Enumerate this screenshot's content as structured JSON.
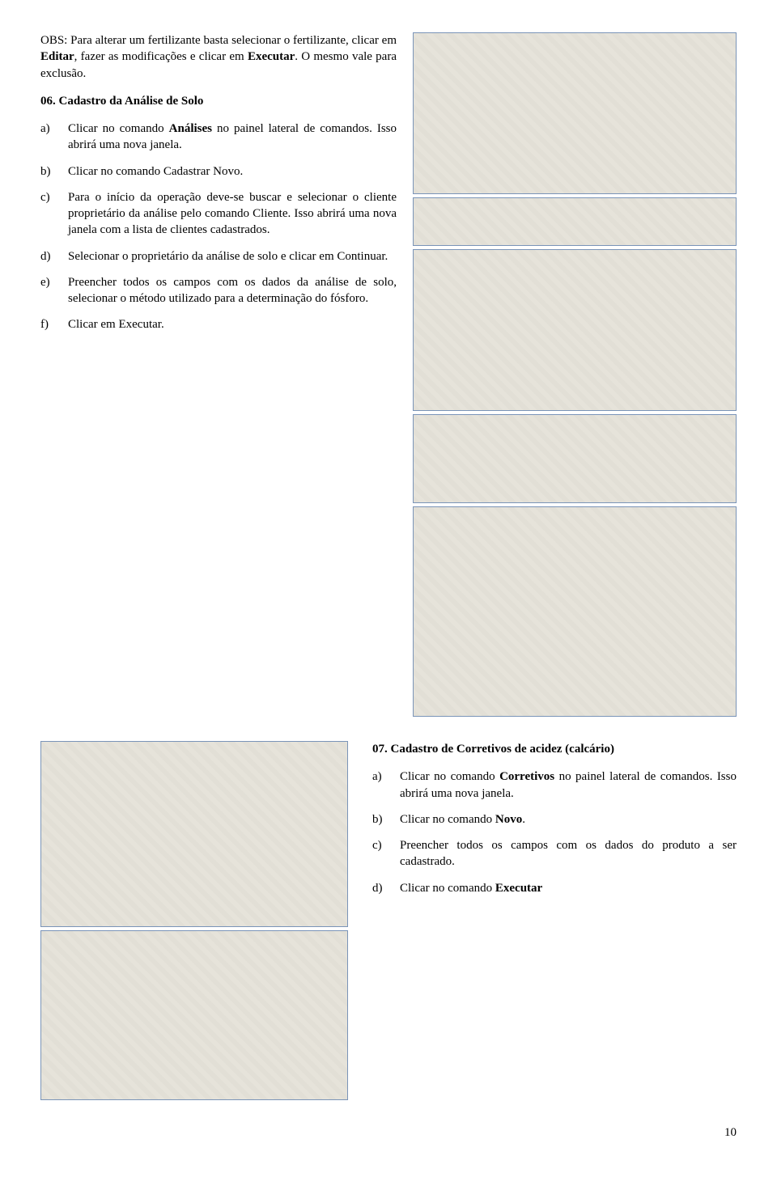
{
  "sec06": {
    "obs": "OBS: Para alterar um fertilizante basta selecionar o fertilizante, clicar em ",
    "obs_b1": "Editar",
    "obs_mid": ", fazer as modificações e clicar em ",
    "obs_b2": "Executar",
    "obs_end": ". O mesmo vale para exclusão.",
    "title": "06. Cadastro da Análise de Solo",
    "a_lbl": "a)",
    "a_pre": "Clicar no comando ",
    "a_b": "Análises",
    "a_post": " no painel lateral de comandos. Isso abrirá uma nova janela.",
    "b_lbl": "b)",
    "b_txt": "Clicar no comando Cadastrar Novo.",
    "c_lbl": "c)",
    "c_txt": "Para o início da operação deve-se buscar e selecionar o cliente proprietário da análise pelo comando Cliente. Isso abrirá uma nova janela com a lista de clientes cadastrados.",
    "d_lbl": "d)",
    "d_txt": "Selecionar o proprietário da análise de solo e clicar em Continuar.",
    "e_lbl": "e)",
    "e_txt": "Preencher todos os campos com os dados da análise de solo, selecionar o método utilizado para a determinação do fósforo.",
    "f_lbl": "f)",
    "f_txt": "Clicar em Executar."
  },
  "sec07": {
    "title": "07. Cadastro de Corretivos de acidez (calcário)",
    "a_lbl": "a)",
    "a_pre": "Clicar no comando ",
    "a_b": "Corretivos",
    "a_post": " no painel lateral de comandos. Isso abrirá uma nova janela.",
    "b_lbl": "b)",
    "b_pre": " Clicar no comando ",
    "b_b": "Novo",
    "b_post": ".",
    "c_lbl": "c)",
    "c_txt": "Preencher todos os campos com os dados do produto a ser cadastrado.",
    "d_lbl": "d)",
    "d_pre": "Clicar no comando ",
    "d_b": "Executar"
  },
  "page": "10"
}
